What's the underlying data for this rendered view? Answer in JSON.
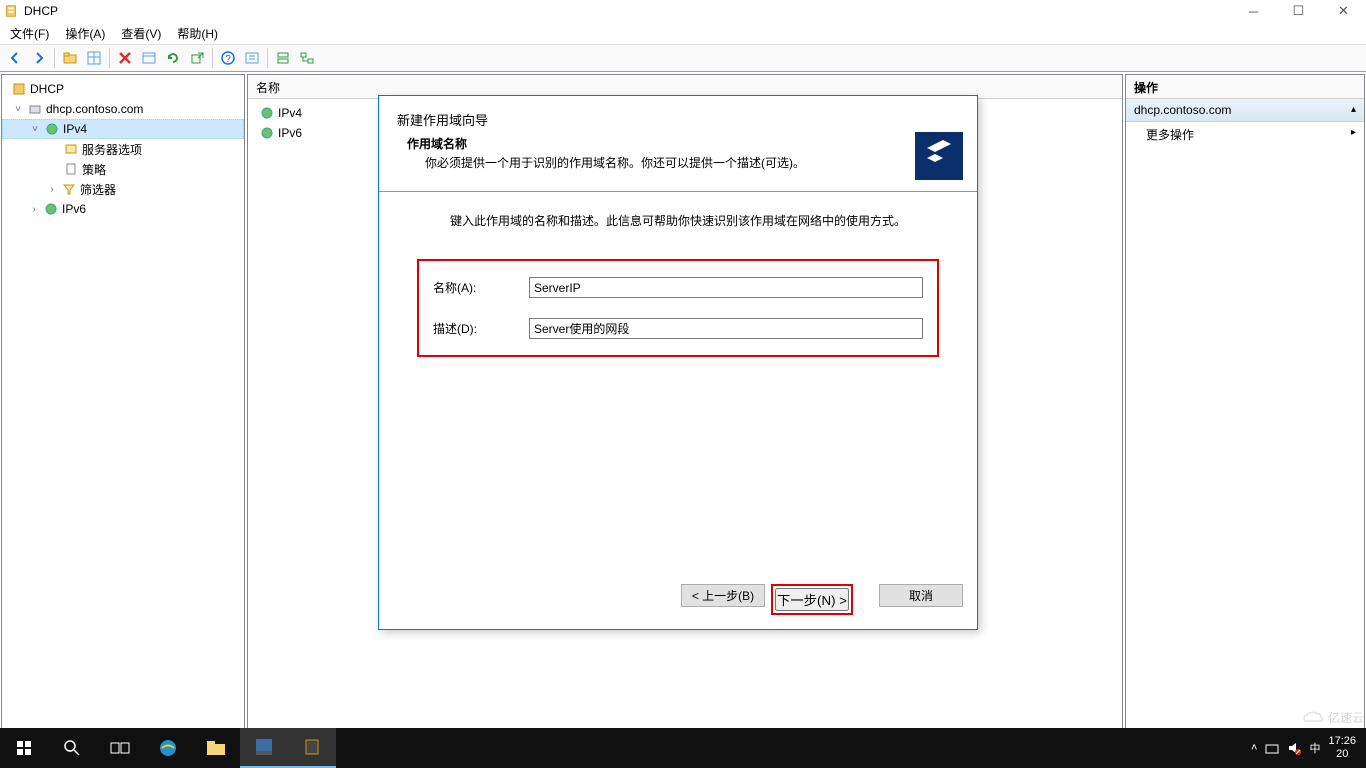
{
  "titlebar": {
    "text": "DHCP"
  },
  "menubar": {
    "file": "文件(F)",
    "action": "操作(A)",
    "view": "查看(V)",
    "help": "帮助(H)"
  },
  "tree": {
    "root": "DHCP",
    "server": "dhcp.contoso.com",
    "ipv4": "IPv4",
    "ipv4_children": [
      {
        "label": "服务器选项"
      },
      {
        "label": "策略"
      },
      {
        "label": "筛选器"
      }
    ],
    "ipv6": "IPv6"
  },
  "content": {
    "header": "名称",
    "items": [
      "IPv4",
      "IPv6"
    ]
  },
  "actions": {
    "header": "操作",
    "section": "dhcp.contoso.com",
    "more": "更多操作"
  },
  "wizard": {
    "title": "新建作用域向导",
    "sub_title": "作用域名称",
    "sub_desc": "你必须提供一个用于识别的作用域名称。你还可以提供一个描述(可选)。",
    "body_hint": "键入此作用域的名称和描述。此信息可帮助你快速识别该作用域在网络中的使用方式。",
    "name_label": "名称(A):",
    "name_value": "ServerIP",
    "desc_label": "描述(D):",
    "desc_value": "Server使用的网段",
    "btn_back": "< 上一步(B)",
    "btn_next": "下一步(N) >",
    "btn_cancel": "取消"
  },
  "taskbar": {
    "time": "17:26",
    "date": "20",
    "ime": "中"
  },
  "watermark": "亿速云"
}
